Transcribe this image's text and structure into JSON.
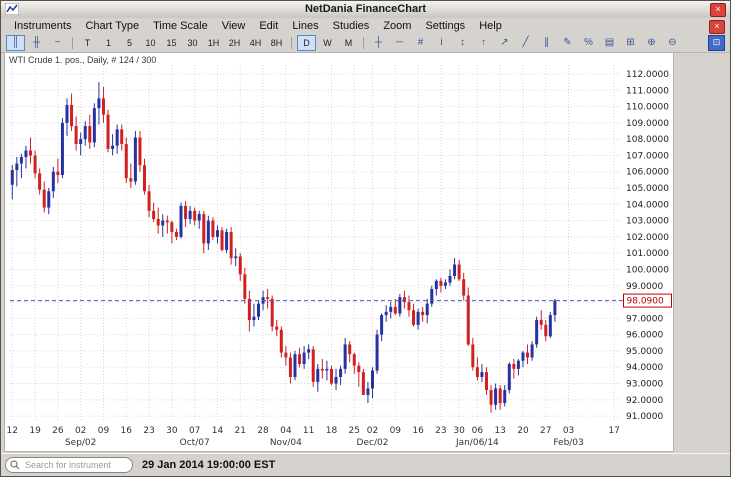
{
  "titlebar": {
    "title": "NetDania FinanceChart",
    "close_glyph": "×"
  },
  "menubar": {
    "close_glyph": "×"
  },
  "menu": {
    "items": [
      "Instruments",
      "Chart Type",
      "Time Scale",
      "View",
      "Edit",
      "Lines",
      "Studies",
      "Zoom",
      "Settings",
      "Help"
    ]
  },
  "toolbar": {
    "chart_type_tools": [
      {
        "name": "candlestick-chart-button",
        "glyph": "║",
        "selected": true
      },
      {
        "name": "bar-chart-button",
        "glyph": "╫",
        "selected": false
      },
      {
        "name": "line-chart-button",
        "glyph": "~",
        "selected": false
      }
    ],
    "timescales": [
      {
        "label": "T",
        "selected": false
      },
      {
        "label": "1",
        "selected": false
      },
      {
        "label": "5",
        "selected": false
      },
      {
        "label": "10",
        "selected": false
      },
      {
        "label": "15",
        "selected": false
      },
      {
        "label": "30",
        "selected": false
      },
      {
        "label": "1H",
        "selected": false
      },
      {
        "label": "2H",
        "selected": false
      },
      {
        "label": "4H",
        "selected": false
      },
      {
        "label": "8H",
        "selected": false
      },
      {
        "label": "D",
        "selected": true
      },
      {
        "label": "W",
        "selected": false
      },
      {
        "label": "M",
        "selected": false
      }
    ],
    "tools": [
      {
        "name": "crosshair-tool-button",
        "glyph": "┼"
      },
      {
        "name": "horizontal-line-tool-button",
        "glyph": "─"
      },
      {
        "name": "grid-tool-button",
        "glyph": "#"
      },
      {
        "name": "info-tool-button",
        "glyph": "i"
      },
      {
        "name": "vertical-scale-button",
        "glyph": "↕"
      },
      {
        "name": "arrow-tool-button",
        "glyph": "↑"
      },
      {
        "name": "trend-arrow-tool-button",
        "glyph": "↗"
      },
      {
        "name": "trendline-tool-button",
        "glyph": "╱"
      },
      {
        "name": "parallel-lines-tool-button",
        "glyph": "∥"
      },
      {
        "name": "pencil-tool-button",
        "glyph": "✎"
      },
      {
        "name": "fibonacci-tool-button",
        "glyph": "%"
      },
      {
        "name": "print-button",
        "glyph": "▤"
      },
      {
        "name": "zoom-area-button",
        "glyph": "⊞"
      },
      {
        "name": "zoom-in-button",
        "glyph": "⊕"
      },
      {
        "name": "zoom-out-button",
        "glyph": "⊖"
      }
    ],
    "dock_glyph": "⊡"
  },
  "statusbar": {
    "search_placeholder": "Search for instrument",
    "timestamp": "29 Jan 2014 19:00:00 EST"
  },
  "chart_data": {
    "type": "candlestick",
    "title": "WTI Crude 1. pos., Daily, # 124 / 300",
    "instrument": "WTI Crude 1. pos.",
    "interval": "Daily",
    "bar_counter": "# 124 / 300",
    "ylim": [
      90.7,
      112.55
    ],
    "y_ticks": [
      112,
      111,
      110,
      109,
      108,
      107,
      106,
      105,
      104,
      103,
      102,
      101,
      100,
      99,
      98,
      97,
      96,
      95,
      94,
      93,
      92,
      91
    ],
    "last_price": 98.09,
    "last_price_label": "98.0900",
    "slots": 134,
    "up_color": "#2433a0",
    "down_color": "#d02020",
    "grid_color": "#d9d9d9",
    "price_line_color": "#5050d0",
    "price_label_color": "#c00000",
    "x_ticks": [
      {
        "label": "12",
        "i": 0
      },
      {
        "label": "19",
        "i": 5
      },
      {
        "label": "26",
        "i": 10
      },
      {
        "label": "02",
        "i": 15
      },
      {
        "label": "09",
        "i": 20
      },
      {
        "label": "16",
        "i": 25
      },
      {
        "label": "23",
        "i": 30
      },
      {
        "label": "30",
        "i": 35
      },
      {
        "label": "07",
        "i": 40
      },
      {
        "label": "14",
        "i": 45
      },
      {
        "label": "21",
        "i": 50
      },
      {
        "label": "28",
        "i": 55
      },
      {
        "label": "04",
        "i": 60
      },
      {
        "label": "11",
        "i": 65
      },
      {
        "label": "18",
        "i": 70
      },
      {
        "label": "25",
        "i": 75
      },
      {
        "label": "02",
        "i": 79
      },
      {
        "label": "09",
        "i": 84
      },
      {
        "label": "16",
        "i": 89
      },
      {
        "label": "23",
        "i": 94
      },
      {
        "label": "30",
        "i": 98
      },
      {
        "label": "06",
        "i": 102
      },
      {
        "label": "13",
        "i": 107
      },
      {
        "label": "20",
        "i": 112
      },
      {
        "label": "27",
        "i": 117
      },
      {
        "label": "03",
        "i": 122
      },
      {
        "label": "17",
        "i": 132
      }
    ],
    "month_ticks": [
      {
        "label": "Sep/02",
        "i": 15
      },
      {
        "label": "Oct/07",
        "i": 40
      },
      {
        "label": "Nov/04",
        "i": 60
      },
      {
        "label": "Dec/02",
        "i": 79
      },
      {
        "label": "Jan/06/14",
        "i": 102
      },
      {
        "label": "Feb/03",
        "i": 122
      }
    ],
    "candles": [
      [
        "2013-08-12",
        105.2,
        106.4,
        104.3,
        106.1
      ],
      [
        "2013-08-13",
        106.1,
        106.9,
        105.1,
        106.5
      ],
      [
        "2013-08-14",
        106.5,
        107.1,
        105.6,
        106.9
      ],
      [
        "2013-08-15",
        106.9,
        107.6,
        106.2,
        107.3
      ],
      [
        "2013-08-16",
        107.3,
        108.1,
        106.5,
        107.0
      ],
      [
        "2013-08-19",
        107.0,
        107.3,
        105.6,
        105.9
      ],
      [
        "2013-08-20",
        105.9,
        106.2,
        104.6,
        104.9
      ],
      [
        "2013-08-21",
        104.9,
        105.4,
        103.5,
        103.8
      ],
      [
        "2013-08-22",
        103.8,
        105.0,
        103.4,
        104.8
      ],
      [
        "2013-08-23",
        104.8,
        106.3,
        104.4,
        106.0
      ],
      [
        "2013-08-26",
        106.0,
        106.8,
        105.3,
        105.8
      ],
      [
        "2013-08-27",
        105.8,
        109.3,
        105.6,
        109.0
      ],
      [
        "2013-08-28",
        109.0,
        110.5,
        108.2,
        110.1
      ],
      [
        "2013-08-29",
        110.1,
        110.8,
        108.5,
        108.8
      ],
      [
        "2013-08-30",
        108.8,
        109.4,
        107.3,
        107.7
      ],
      [
        "2013-09-02",
        107.7,
        108.4,
        107.0,
        108.0
      ],
      [
        "2013-09-03",
        108.0,
        109.1,
        107.6,
        108.8
      ],
      [
        "2013-09-04",
        108.8,
        109.5,
        107.4,
        107.8
      ],
      [
        "2013-09-05",
        107.8,
        110.2,
        107.5,
        109.9
      ],
      [
        "2013-09-06",
        109.9,
        111.5,
        108.9,
        110.5
      ],
      [
        "2013-09-09",
        110.5,
        111.2,
        109.0,
        109.5
      ],
      [
        "2013-09-10",
        109.5,
        109.8,
        107.2,
        107.4
      ],
      [
        "2013-09-11",
        107.4,
        108.3,
        107.0,
        107.6
      ],
      [
        "2013-09-12",
        107.6,
        108.9,
        107.1,
        108.6
      ],
      [
        "2013-09-13",
        108.6,
        108.9,
        107.3,
        107.7
      ],
      [
        "2013-09-16",
        107.7,
        108.1,
        105.3,
        105.6
      ],
      [
        "2013-09-17",
        105.6,
        106.5,
        105.0,
        105.4
      ],
      [
        "2013-09-18",
        105.4,
        108.5,
        105.2,
        108.1
      ],
      [
        "2013-09-19",
        108.1,
        108.5,
        106.0,
        106.4
      ],
      [
        "2013-09-20",
        106.4,
        106.8,
        104.6,
        104.8
      ],
      [
        "2013-09-23",
        104.8,
        105.2,
        103.2,
        103.6
      ],
      [
        "2013-09-24",
        103.6,
        104.1,
        102.9,
        103.1
      ],
      [
        "2013-09-25",
        103.1,
        103.8,
        102.2,
        102.7
      ],
      [
        "2013-09-26",
        102.7,
        103.4,
        102.0,
        103.0
      ],
      [
        "2013-09-27",
        103.0,
        103.3,
        102.2,
        102.9
      ],
      [
        "2013-09-30",
        102.9,
        103.0,
        101.6,
        102.3
      ],
      [
        "2013-10-01",
        102.3,
        102.5,
        101.8,
        102.0
      ],
      [
        "2013-10-02",
        102.0,
        104.1,
        101.9,
        103.9
      ],
      [
        "2013-10-03",
        103.9,
        104.2,
        102.6,
        103.1
      ],
      [
        "2013-10-04",
        103.1,
        103.9,
        102.8,
        103.6
      ],
      [
        "2013-10-07",
        103.6,
        103.8,
        102.7,
        103.0
      ],
      [
        "2013-10-08",
        103.0,
        103.6,
        102.5,
        103.4
      ],
      [
        "2013-10-09",
        103.4,
        103.6,
        101.0,
        101.6
      ],
      [
        "2013-10-10",
        101.6,
        103.3,
        101.2,
        103.0
      ],
      [
        "2013-10-11",
        103.0,
        103.2,
        101.8,
        102.0
      ],
      [
        "2013-10-14",
        102.0,
        102.7,
        101.6,
        102.4
      ],
      [
        "2013-10-15",
        102.4,
        102.6,
        101.1,
        101.2
      ],
      [
        "2013-10-16",
        101.2,
        102.5,
        101.0,
        102.3
      ],
      [
        "2013-10-17",
        102.3,
        102.6,
        100.3,
        100.7
      ],
      [
        "2013-10-18",
        100.7,
        101.3,
        100.2,
        100.8
      ],
      [
        "2013-10-21",
        100.8,
        101.0,
        99.3,
        99.7
      ],
      [
        "2013-10-22",
        99.7,
        100.1,
        97.9,
        98.2
      ],
      [
        "2013-10-23",
        98.2,
        98.7,
        96.2,
        96.9
      ],
      [
        "2013-10-24",
        96.9,
        97.9,
        96.5,
        97.1
      ],
      [
        "2013-10-25",
        97.1,
        98.1,
        96.9,
        97.9
      ],
      [
        "2013-10-28",
        97.9,
        98.7,
        97.5,
        98.3
      ],
      [
        "2013-10-29",
        98.3,
        98.8,
        97.6,
        98.2
      ],
      [
        "2013-10-30",
        98.2,
        98.4,
        96.2,
        96.5
      ],
      [
        "2013-10-31",
        96.5,
        96.9,
        95.9,
        96.3
      ],
      [
        "2013-11-01",
        96.3,
        96.5,
        94.6,
        94.9
      ],
      [
        "2013-11-04",
        94.9,
        95.3,
        94.1,
        94.6
      ],
      [
        "2013-11-05",
        94.6,
        94.9,
        93.0,
        93.4
      ],
      [
        "2013-11-06",
        93.4,
        95.0,
        93.2,
        94.8
      ],
      [
        "2013-11-07",
        94.8,
        95.2,
        94.0,
        94.2
      ],
      [
        "2013-11-08",
        94.2,
        95.3,
        93.9,
        94.9
      ],
      [
        "2013-11-11",
        94.9,
        95.4,
        94.5,
        95.1
      ],
      [
        "2013-11-12",
        95.1,
        95.3,
        92.8,
        93.1
      ],
      [
        "2013-11-13",
        93.1,
        94.2,
        92.5,
        93.9
      ],
      [
        "2013-11-14",
        93.9,
        94.5,
        93.3,
        93.8
      ],
      [
        "2013-11-15",
        93.8,
        94.4,
        93.2,
        93.9
      ],
      [
        "2013-11-18",
        93.9,
        94.1,
        92.9,
        93.0
      ],
      [
        "2013-11-19",
        93.0,
        93.9,
        92.6,
        93.4
      ],
      [
        "2013-11-20",
        93.4,
        94.1,
        92.9,
        93.9
      ],
      [
        "2013-11-21",
        93.9,
        95.8,
        93.6,
        95.4
      ],
      [
        "2013-11-22",
        95.4,
        95.6,
        94.3,
        94.8
      ],
      [
        "2013-11-25",
        94.8,
        94.9,
        93.6,
        94.1
      ],
      [
        "2013-11-26",
        94.1,
        94.3,
        92.8,
        93.7
      ],
      [
        "2013-11-27",
        93.7,
        93.9,
        92.3,
        92.3
      ],
      [
        "2013-11-29",
        92.3,
        93.1,
        91.8,
        92.7
      ],
      [
        "2013-12-02",
        92.7,
        94.0,
        92.1,
        93.8
      ],
      [
        "2013-12-03",
        93.8,
        96.3,
        93.6,
        96.0
      ],
      [
        "2013-12-04",
        96.0,
        97.3,
        95.6,
        97.2
      ],
      [
        "2013-12-05",
        97.2,
        97.8,
        96.8,
        97.4
      ],
      [
        "2013-12-06",
        97.4,
        98.0,
        97.0,
        97.7
      ],
      [
        "2013-12-09",
        97.7,
        98.2,
        97.2,
        97.3
      ],
      [
        "2013-12-10",
        97.3,
        98.5,
        97.1,
        98.3
      ],
      [
        "2013-12-11",
        98.3,
        98.7,
        97.6,
        98.0
      ],
      [
        "2013-12-12",
        98.0,
        98.4,
        97.1,
        97.5
      ],
      [
        "2013-12-13",
        97.5,
        97.9,
        96.5,
        96.6
      ],
      [
        "2013-12-16",
        96.6,
        97.6,
        96.3,
        97.4
      ],
      [
        "2013-12-17",
        97.4,
        97.7,
        96.8,
        97.2
      ],
      [
        "2013-12-18",
        97.2,
        98.2,
        96.7,
        97.9
      ],
      [
        "2013-12-19",
        97.9,
        99.0,
        97.7,
        98.8
      ],
      [
        "2013-12-20",
        98.8,
        99.4,
        98.4,
        99.3
      ],
      [
        "2013-12-23",
        99.3,
        99.5,
        98.6,
        99.0
      ],
      [
        "2013-12-24",
        99.0,
        99.4,
        98.8,
        99.2
      ],
      [
        "2013-12-26",
        99.2,
        100.0,
        99.0,
        99.6
      ],
      [
        "2013-12-27",
        99.6,
        100.7,
        99.4,
        100.3
      ],
      [
        "2013-12-30",
        100.3,
        100.6,
        99.3,
        99.4
      ],
      [
        "2013-12-31",
        99.4,
        99.8,
        98.1,
        98.4
      ],
      [
        "2014-01-02",
        98.4,
        98.9,
        95.3,
        95.4
      ],
      [
        "2014-01-03",
        95.4,
        95.8,
        93.8,
        94.0
      ],
      [
        "2014-01-06",
        94.0,
        94.6,
        93.2,
        93.4
      ],
      [
        "2014-01-07",
        93.4,
        94.2,
        93.1,
        93.7
      ],
      [
        "2014-01-08",
        93.7,
        94.0,
        92.3,
        92.6
      ],
      [
        "2014-01-09",
        92.6,
        92.9,
        91.2,
        91.7
      ],
      [
        "2014-01-10",
        91.7,
        93.0,
        91.4,
        92.7
      ],
      [
        "2014-01-13",
        92.7,
        92.9,
        91.4,
        91.8
      ],
      [
        "2014-01-14",
        91.8,
        92.9,
        91.6,
        92.6
      ],
      [
        "2014-01-15",
        92.6,
        94.3,
        92.4,
        94.2
      ],
      [
        "2014-01-16",
        94.2,
        94.5,
        93.3,
        93.9
      ],
      [
        "2014-01-17",
        93.9,
        94.5,
        93.5,
        94.4
      ],
      [
        "2014-01-20",
        94.4,
        95.0,
        94.0,
        94.9
      ],
      [
        "2014-01-21",
        94.9,
        95.4,
        94.2,
        94.6
      ],
      [
        "2014-01-22",
        94.6,
        95.6,
        94.4,
        95.4
      ],
      [
        "2014-01-23",
        95.4,
        97.1,
        95.2,
        96.9
      ],
      [
        "2014-01-24",
        96.9,
        97.5,
        96.3,
        96.6
      ],
      [
        "2014-01-27",
        96.6,
        96.9,
        95.6,
        95.9
      ],
      [
        "2014-01-28",
        95.9,
        97.4,
        95.8,
        97.2
      ],
      [
        "2014-01-29",
        97.2,
        98.2,
        96.8,
        98.09
      ]
    ]
  }
}
